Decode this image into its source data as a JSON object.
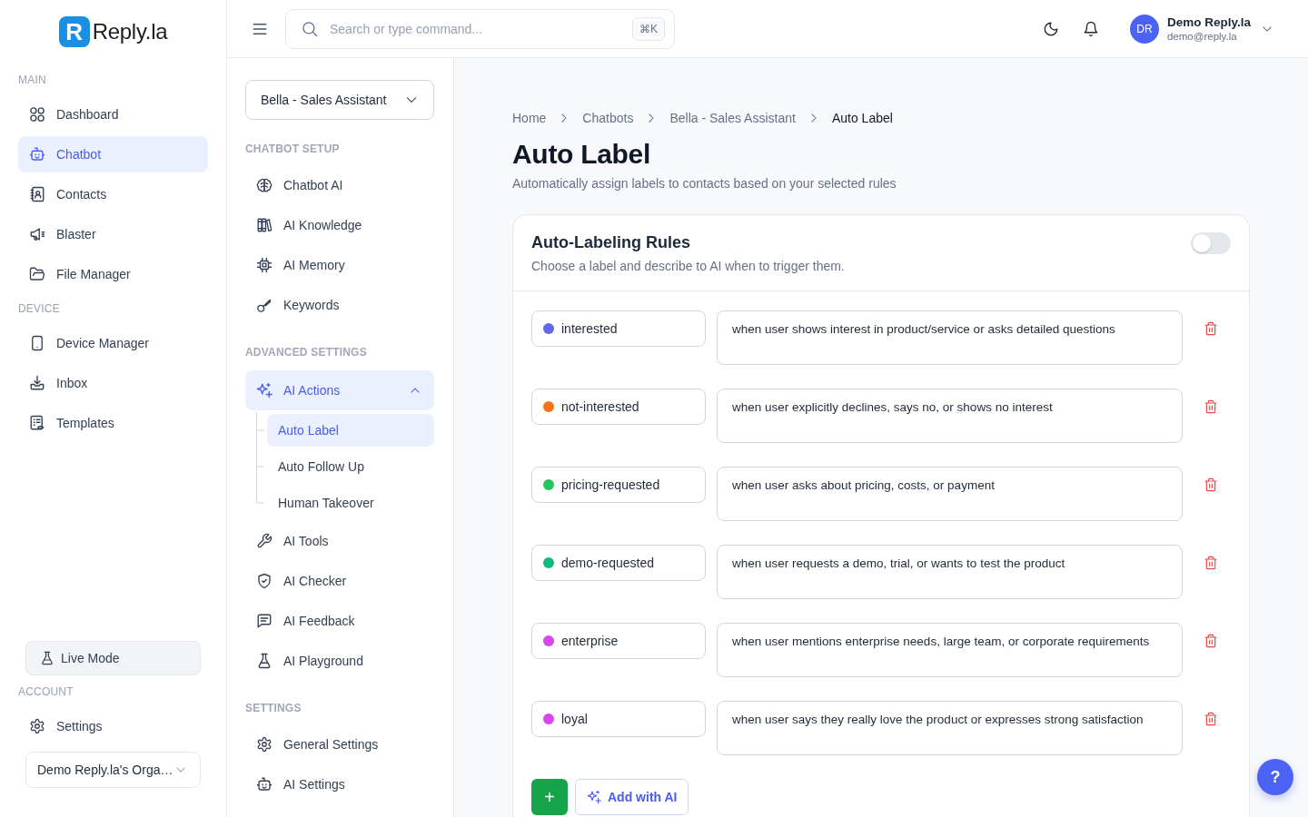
{
  "sidebar": {
    "logo": {
      "mark": "R",
      "name": "Reply.la"
    },
    "sections": [
      {
        "title": "MAIN",
        "items": [
          {
            "label": "Dashboard",
            "selected": false
          },
          {
            "label": "Chatbot",
            "selected": true
          },
          {
            "label": "Contacts",
            "selected": false
          },
          {
            "label": "Blaster",
            "selected": false
          },
          {
            "label": "File Manager",
            "selected": false
          }
        ]
      },
      {
        "title": "DEVICE",
        "items": [
          {
            "label": "Device Manager",
            "selected": false
          },
          {
            "label": "Inbox",
            "selected": false
          },
          {
            "label": "Templates",
            "selected": false
          }
        ]
      }
    ],
    "live_mode_button": "Live Mode",
    "account": {
      "title": "ACCOUNT",
      "items": [
        {
          "label": "Settings",
          "selected": false
        }
      ]
    },
    "organization_select": "Demo Reply.la's Orga…"
  },
  "top_bar": {
    "search": {
      "placeholder": "Search or type command...",
      "shortcut": "⌘K"
    },
    "user": {
      "initials": "DR",
      "name": "Demo Reply.la",
      "email": "demo@reply.la"
    }
  },
  "chatbot_nav": {
    "bot_select": "Bella - Sales Assistant",
    "sections": [
      {
        "title": "CHATBOT SETUP",
        "items": [
          {
            "label": "Chatbot AI",
            "selected": false
          },
          {
            "label": "AI Knowledge",
            "selected": false
          },
          {
            "label": "AI Memory",
            "selected": false
          },
          {
            "label": "Keywords",
            "selected": false
          }
        ]
      },
      {
        "title": "ADVANCED SETTINGS",
        "items": [
          {
            "label": "AI Actions",
            "selected": true,
            "expanded": true,
            "children": [
              {
                "label": "Auto Label",
                "selected": true
              },
              {
                "label": "Auto Follow Up",
                "selected": false
              },
              {
                "label": "Human Takeover",
                "selected": false
              }
            ]
          },
          {
            "label": "AI Tools",
            "selected": false
          },
          {
            "label": "AI Checker",
            "selected": false
          },
          {
            "label": "AI Feedback",
            "selected": false
          },
          {
            "label": "AI Playground",
            "selected": false
          }
        ]
      },
      {
        "title": "SETTINGS",
        "items": [
          {
            "label": "General Settings",
            "selected": false
          },
          {
            "label": "AI Settings",
            "selected": false
          }
        ]
      }
    ]
  },
  "page": {
    "breadcrumb": [
      {
        "label": "Home",
        "current": false
      },
      {
        "label": "Chatbots",
        "current": false
      },
      {
        "label": "Bella - Sales Assistant",
        "current": false
      },
      {
        "label": "Auto Label",
        "current": true
      }
    ],
    "title": "Auto Label",
    "subtitle": "Automatically assign labels to contacts based on your selected rules"
  },
  "rules_card": {
    "title": "Auto-Labeling Rules",
    "subtitle": "Choose a label and describe to AI when to trigger them.",
    "enabled": false,
    "rules": [
      {
        "label": "interested",
        "color": "#6366f1",
        "description": "when user shows interest in product/service or asks detailed questions"
      },
      {
        "label": "not-interested",
        "color": "#f97316",
        "description": "when user explicitly declines, says no, or shows no interest"
      },
      {
        "label": "pricing-requested",
        "color": "#22c55e",
        "description": "when user asks about pricing, costs, or payment"
      },
      {
        "label": "demo-requested",
        "color": "#10b981",
        "description": "when user requests a demo, trial, or wants to test the product"
      },
      {
        "label": "enterprise",
        "color": "#d946ef",
        "description": "when user mentions enterprise needs, large team, or corporate requirements"
      },
      {
        "label": "loyal",
        "color": "#d946ef",
        "description": "when user says they really love the product or expresses strong satisfaction"
      }
    ],
    "add_button": "+",
    "add_ai_button": "Add with AI"
  },
  "help_button": "?"
}
